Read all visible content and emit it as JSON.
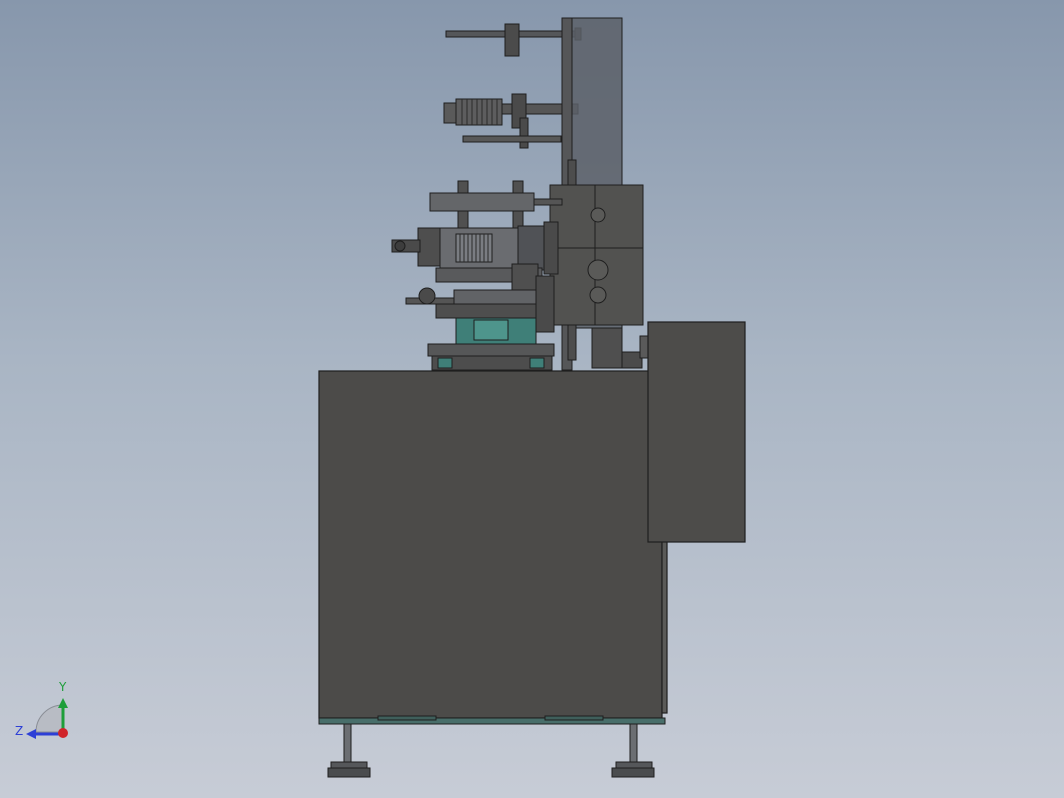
{
  "viewport": {
    "background_top": "#8797ac",
    "background_bottom": "#c7ccd6",
    "model_body_color": "#4c4b49",
    "model_edge_color": "#1e1e1e",
    "accent_teal": "#3f7f78"
  },
  "triad": {
    "y_label": "Y",
    "z_label": "Z",
    "y_color": "#1e9e3a",
    "z_color": "#2d3fd6",
    "x_color": "#d0242a"
  }
}
